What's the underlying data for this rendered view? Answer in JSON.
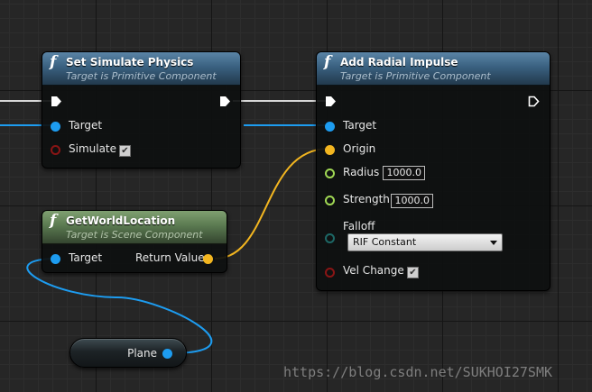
{
  "colors": {
    "exec_wire": "#ffffff",
    "object_pin": "#1d9cf0",
    "vector_pin": "#f3b620",
    "float_pin": "#a0d854",
    "bool_pin": "#8a1515",
    "enum_pin": "#1d6866",
    "function_header": "#3a6180",
    "pure_header": "#5b7a51"
  },
  "icons": {
    "function": "function-icon",
    "exec": "exec-pin-icon",
    "check": "checkmark-icon"
  },
  "set_simulate_physics": {
    "function_glyph": "f",
    "title": "Set Simulate Physics",
    "subtitle": "Target is Primitive Component",
    "target_label": "Target",
    "simulate_label": "Simulate",
    "simulate_checked": true
  },
  "add_radial_impulse": {
    "function_glyph": "f",
    "title": "Add Radial Impulse",
    "subtitle": "Target is Primitive Component",
    "target_label": "Target",
    "origin_label": "Origin",
    "radius_label": "Radius",
    "radius_value": "1000.0",
    "strength_label": "Strength",
    "strength_value": "1000.0",
    "falloff_label": "Falloff",
    "falloff_value": "RIF Constant",
    "vel_change_label": "Vel Change",
    "vel_change_checked": true
  },
  "get_world_location": {
    "function_glyph": "f",
    "title": "GetWorldLocation",
    "subtitle": "Target is Scene Component",
    "target_label": "Target",
    "return_label": "Return Value"
  },
  "variable_node": {
    "label": "Plane"
  },
  "watermark": "https://blog.csdn.net/SUKHOI27SMK"
}
